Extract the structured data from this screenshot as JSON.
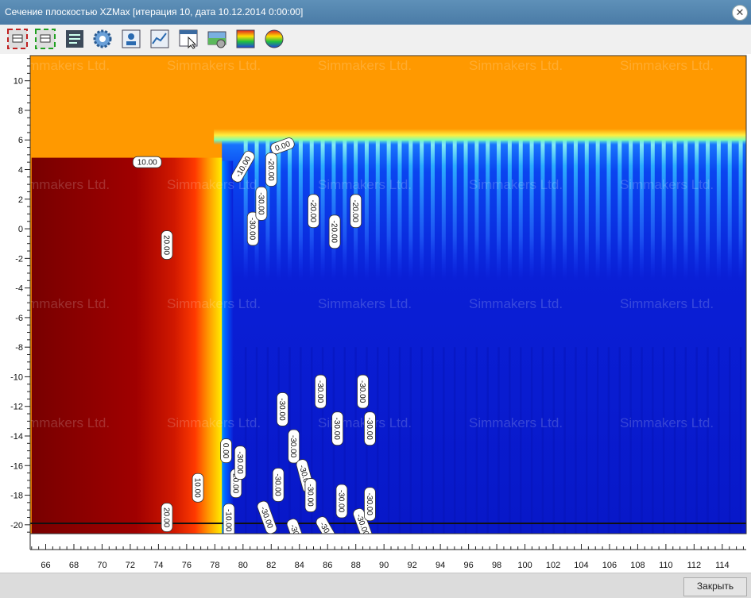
{
  "window": {
    "title": "Сечение плоскостью XZMax [итерация 10, дата 10.12.2014 0:00:00]",
    "close_glyph": "✕"
  },
  "toolbar": {
    "icons": [
      "frame-red-icon",
      "frame-green-icon",
      "list-settings-icon",
      "gear-icon",
      "profile-icon",
      "chart-icon",
      "cursor-window-icon",
      "layer-settings-icon",
      "palette-icon",
      "sphere-icon"
    ]
  },
  "watermark": "Simmakers Ltd.",
  "footer": {
    "close_label": "Закрыть"
  },
  "chart_data": {
    "type": "heatmap",
    "title": "",
    "xlabel": "",
    "ylabel": "",
    "xlim": [
      64.9,
      115.7
    ],
    "ylim": [
      -20.6,
      11.7
    ],
    "x_ticks": [
      "66",
      "68",
      "70",
      "72",
      "74",
      "76",
      "78",
      "80",
      "82",
      "84",
      "86",
      "88",
      "90",
      "92",
      "94",
      "96",
      "98",
      "100",
      "102",
      "104",
      "106",
      "108",
      "110",
      "112",
      "114"
    ],
    "y_ticks": [
      "10",
      "8",
      "6",
      "4",
      "2",
      "0",
      "-2",
      "-4",
      "-6",
      "-8",
      "-10",
      "-12",
      "-14",
      "-16",
      "-18",
      "-20"
    ],
    "colors": {
      "warm": "#8b0000",
      "mid": "#ffee00",
      "cold": "#0a1fd6",
      "air": "#ff9900"
    },
    "zones": [
      {
        "name": "air",
        "y_bottom": 5.8
      },
      {
        "name": "warm ground",
        "x_from": 65,
        "x_to": 78.5,
        "y_top": 4.8,
        "value": "20.00"
      },
      {
        "name": "frozen ground",
        "x_from": 78.5,
        "x_to": 115.7,
        "y_top": 6.0,
        "value": "-30.00"
      }
    ],
    "isotherm_labels": [
      {
        "x": 73.2,
        "y": 4.5,
        "t": "10.00",
        "r": 0
      },
      {
        "x": 74.6,
        "y": -1.1,
        "t": "20.00",
        "r": 90
      },
      {
        "x": 74.6,
        "y": -19.5,
        "t": "20.00",
        "r": 90
      },
      {
        "x": 76.8,
        "y": -17.5,
        "t": "10.00",
        "r": 90
      },
      {
        "x": 78.8,
        "y": -15.0,
        "t": "0.00",
        "r": 90
      },
      {
        "x": 79.0,
        "y": -19.7,
        "t": "-10.00",
        "r": 90
      },
      {
        "x": 79.5,
        "y": -17.2,
        "t": "20.00",
        "r": 90
      },
      {
        "x": 79.8,
        "y": -15.8,
        "t": "-30.00",
        "r": 90
      },
      {
        "x": 80.0,
        "y": 4.2,
        "t": "-10.00",
        "r": -60
      },
      {
        "x": 80.7,
        "y": 0.0,
        "t": "-30.00",
        "r": 90
      },
      {
        "x": 81.3,
        "y": 1.7,
        "t": "-30.00",
        "r": 90
      },
      {
        "x": 82.0,
        "y": 4.0,
        "t": "-20.00",
        "r": 90
      },
      {
        "x": 82.8,
        "y": 5.6,
        "t": "0.00",
        "r": -20
      },
      {
        "x": 81.7,
        "y": -19.5,
        "t": "-30.00",
        "r": 70
      },
      {
        "x": 82.5,
        "y": -17.3,
        "t": "-30.00",
        "r": 90
      },
      {
        "x": 82.8,
        "y": -12.2,
        "t": "-30.00",
        "r": 90
      },
      {
        "x": 83.6,
        "y": -14.7,
        "t": "-30.00",
        "r": 90
      },
      {
        "x": 83.8,
        "y": -20.7,
        "t": "-30.00",
        "r": 70
      },
      {
        "x": 84.4,
        "y": -16.7,
        "t": "-30.00",
        "r": 75
      },
      {
        "x": 84.8,
        "y": -18.0,
        "t": "-30.00",
        "r": 90
      },
      {
        "x": 85.0,
        "y": 1.2,
        "t": "-20.00",
        "r": 90
      },
      {
        "x": 85.5,
        "y": -11.0,
        "t": "-30.00",
        "r": 90
      },
      {
        "x": 86.0,
        "y": -20.5,
        "t": "-30.00",
        "r": 60
      },
      {
        "x": 86.5,
        "y": -0.2,
        "t": "-20.00",
        "r": 90
      },
      {
        "x": 86.7,
        "y": -13.5,
        "t": "-30.00",
        "r": 90
      },
      {
        "x": 87.0,
        "y": -18.4,
        "t": "-30.00",
        "r": 90
      },
      {
        "x": 88.0,
        "y": 1.2,
        "t": "-20.00",
        "r": 90
      },
      {
        "x": 88.5,
        "y": -11.0,
        "t": "-30.00",
        "r": 90
      },
      {
        "x": 88.5,
        "y": -20.0,
        "t": "-30.00",
        "r": 70
      },
      {
        "x": 89.0,
        "y": -13.5,
        "t": "-30.00",
        "r": 90
      },
      {
        "x": 89.0,
        "y": -18.6,
        "t": "-30.00",
        "r": 90
      }
    ]
  }
}
